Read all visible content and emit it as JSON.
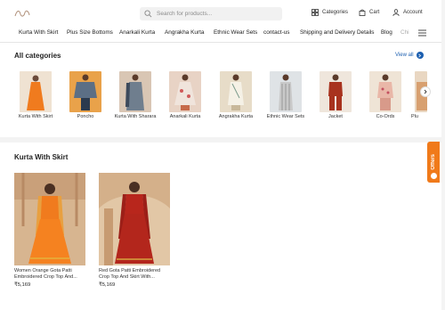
{
  "header": {
    "search_placeholder": "Search for products...",
    "categories_label": "Categories",
    "cart_label": "Cart",
    "account_label": "Account"
  },
  "nav": {
    "items": [
      "Kurta With Skirt",
      "Plus Size Bottoms",
      "Anarkali Kurta",
      "Angrakha Kurta",
      "Ethnic Wear Sets",
      "contact-us",
      "Shipping and Delivery Details",
      "Blog",
      "Chi"
    ]
  },
  "categories_section": {
    "title": "All categories",
    "view_all": "View all",
    "items": [
      {
        "label": "Kurta With Skirt"
      },
      {
        "label": "Poncho"
      },
      {
        "label": "Kurta With Sharara"
      },
      {
        "label": "Anarkali Kurta"
      },
      {
        "label": "Angrakha Kurta"
      },
      {
        "label": "Ethnic Wear Sets"
      },
      {
        "label": "Jacket"
      },
      {
        "label": "Co-Ords"
      },
      {
        "label": "Plu"
      }
    ]
  },
  "products_section": {
    "title": "Kurta With Skirt",
    "products": [
      {
        "name_line1": "Women Orange Gota Patti",
        "name_line2": "Embroidered Crop Top And...",
        "price": "₹5,169"
      },
      {
        "name_line1": "Red Gota Patti Embroidered",
        "name_line2": "Crop Top And Skirt With...",
        "price": "₹5,169"
      }
    ]
  },
  "offers": {
    "label": "Offers"
  },
  "colors": {
    "accent": "#1c5fb0",
    "offers": "#f07a1a"
  }
}
